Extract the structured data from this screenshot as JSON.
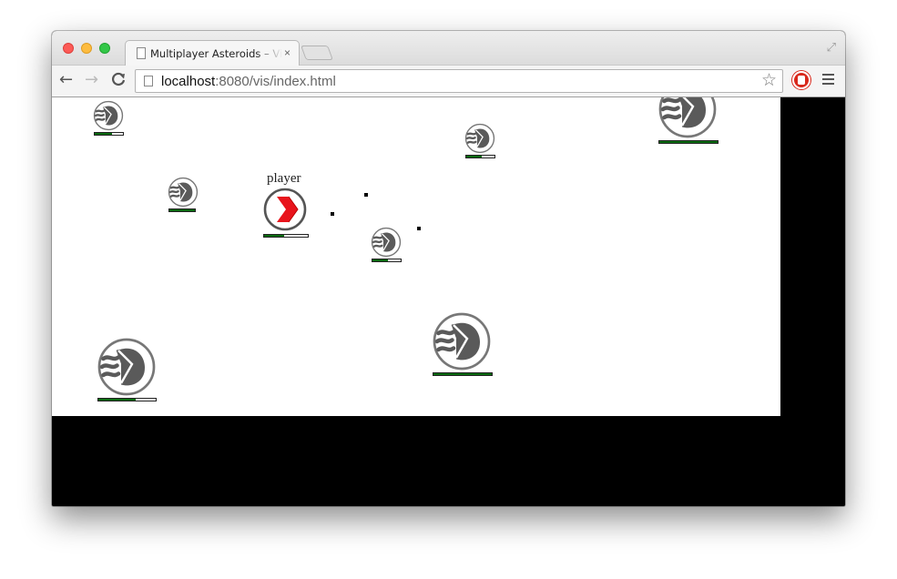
{
  "browser": {
    "tab_title": "Multiplayer Asteroids – Vis",
    "tab_close": "×",
    "url_host": "localhost",
    "url_rest": ":8080/vis/index.html",
    "back_icon": "←",
    "forward_icon": "→",
    "reload_icon": "C",
    "star_icon": "☆",
    "expand_icon": "⤢"
  },
  "game": {
    "player": {
      "label": "player",
      "health": 0.45
    },
    "asteroids": [
      {
        "health": 0.6
      },
      {
        "health": 0.55
      },
      {
        "health": 1.0
      },
      {
        "health": 1.0
      },
      {
        "health": 0.55
      },
      {
        "health": 1.0
      },
      {
        "health": 0.65
      }
    ],
    "bullets": 3
  },
  "colors": {
    "health_fill": "#0b6a11",
    "ship_chevron": "#e8141c",
    "asteroid_gray": "#5a5a5a"
  }
}
